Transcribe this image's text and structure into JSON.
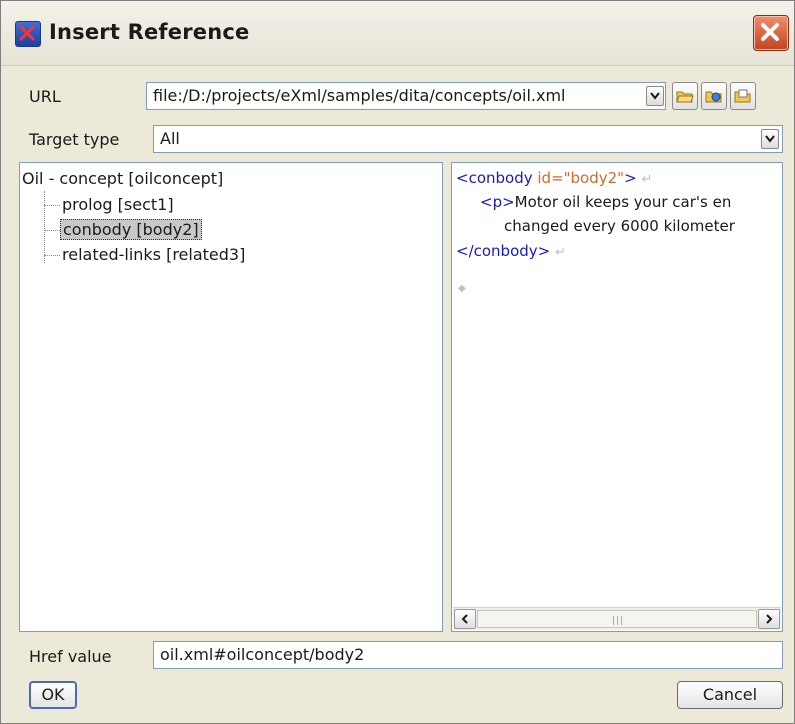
{
  "window": {
    "title": "Insert Reference"
  },
  "url": {
    "label": "URL",
    "value": "file:/D:/projects/eXml/samples/dita/concepts/oil.xml",
    "buttons": [
      "open-folder-icon",
      "browse-icon",
      "open-recent-icon"
    ]
  },
  "target_type": {
    "label": "Target type",
    "value": "All"
  },
  "tree": {
    "root": "Oil - concept [oilconcept]",
    "children": [
      {
        "label": "prolog [sect1]",
        "selected": false
      },
      {
        "label": "conbody [body2]",
        "selected": true
      },
      {
        "label": "related-links [related3]",
        "selected": false
      }
    ]
  },
  "preview": {
    "line1_open": "<conbody",
    "line1_attr": " id=\"body2\"",
    "line1_close": ">",
    "line2_tag": "<p>",
    "line2_text": "Motor oil keeps your car's en",
    "line3_text": "changed  every 6000 kilometer",
    "line4_tag": "</conbody>",
    "return_mark": "↵",
    "end_mark": "◆"
  },
  "href": {
    "label": "Href value",
    "value": "oil.xml#oilconcept/body2"
  },
  "buttons": {
    "ok": "OK",
    "cancel": "Cancel"
  },
  "colors": {
    "tag": "#1818c8",
    "attribute": "#d06a2a",
    "dialog_background": "#ece9d8"
  }
}
